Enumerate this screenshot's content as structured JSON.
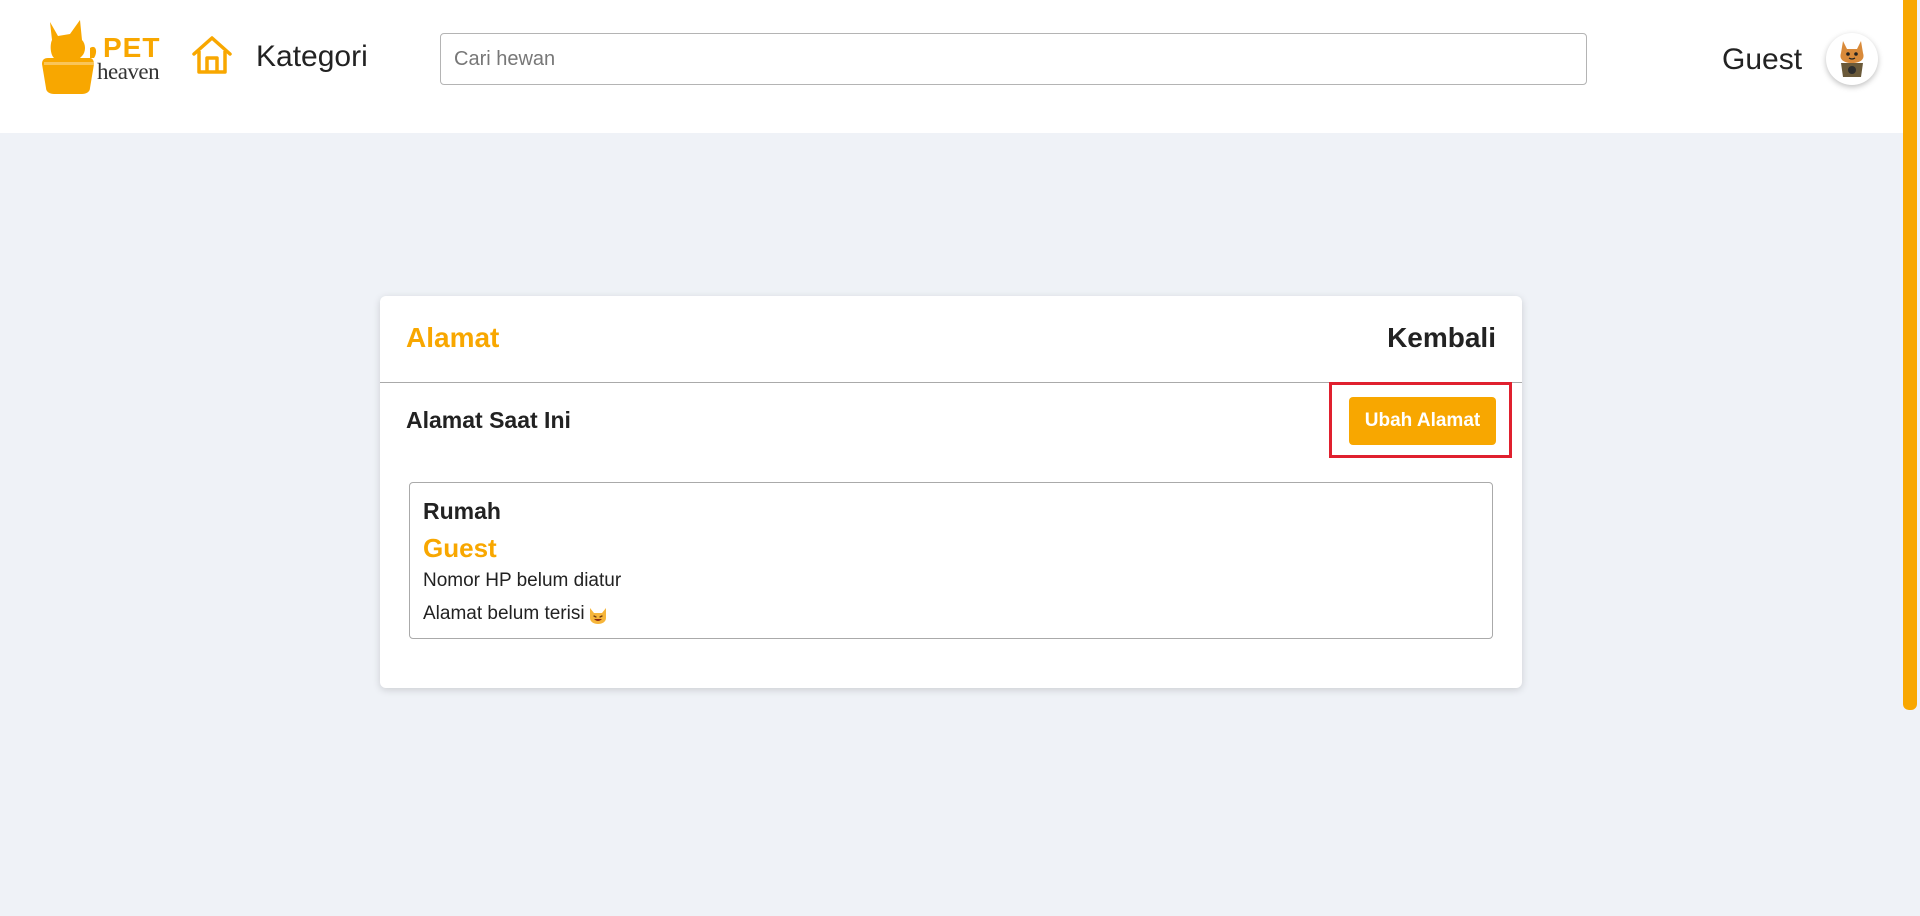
{
  "header": {
    "logo": {
      "top_text": "PET",
      "bottom_text": "heaven"
    },
    "nav_label": "Kategori",
    "search": {
      "placeholder": "Cari hewan",
      "value": ""
    },
    "user_name": "Guest"
  },
  "page": {
    "title": "Alamat",
    "back_label": "Kembali",
    "section_label": "Alamat Saat Ini",
    "edit_button_label": "Ubah Alamat"
  },
  "address": {
    "label": "Rumah",
    "name": "Guest",
    "phone": "Nomor HP belum diatur",
    "street": "Alamat belum terisi"
  },
  "icons": {
    "home": "home-icon",
    "logo": "cat-logo-icon",
    "avatar": "avatar-cat-icon",
    "street_emoji": "cat-emoji-icon"
  },
  "colors": {
    "accent": "#f8a700",
    "background": "#eff2f7",
    "highlight": "#e0202e"
  }
}
